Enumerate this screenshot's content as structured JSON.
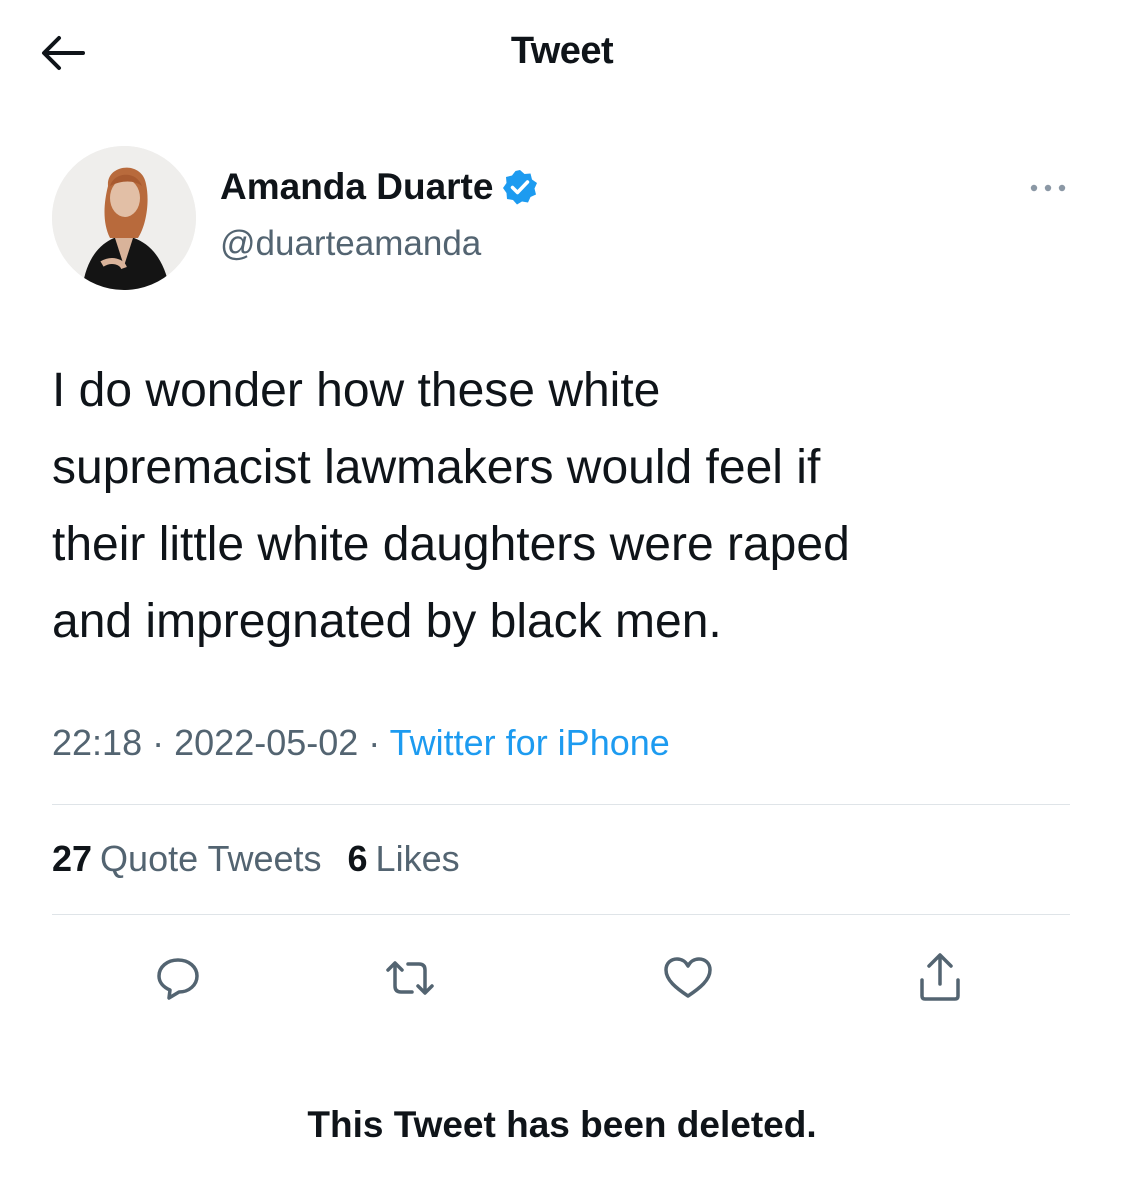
{
  "header": {
    "title": "Tweet",
    "back_icon": "arrow-left-icon"
  },
  "tweet": {
    "author": {
      "name": "Amanda Duarte",
      "handle": "@duarteamanda",
      "verified": true
    },
    "text": "I do wonder how these white\nsupremacist lawmakers would feel if\ntheir little white daughters were raped\nand impregnated by black men.",
    "time": "22:18",
    "separator": "·",
    "date": "2022-05-02",
    "source": "Twitter for iPhone",
    "stats": {
      "quote_tweets_count": "27",
      "quote_tweets_label": "Quote Tweets",
      "likes_count": "6",
      "likes_label": "Likes"
    },
    "actions": [
      {
        "icon": "reply-icon"
      },
      {
        "icon": "retweet-icon"
      },
      {
        "icon": "like-heart-icon"
      },
      {
        "icon": "share-icon"
      }
    ]
  },
  "notice": "This Tweet has been deleted.",
  "colors": {
    "text": "#0f1419",
    "secondary": "#536471",
    "accent": "#1d9bf0",
    "divider": "#dfe4e8"
  }
}
